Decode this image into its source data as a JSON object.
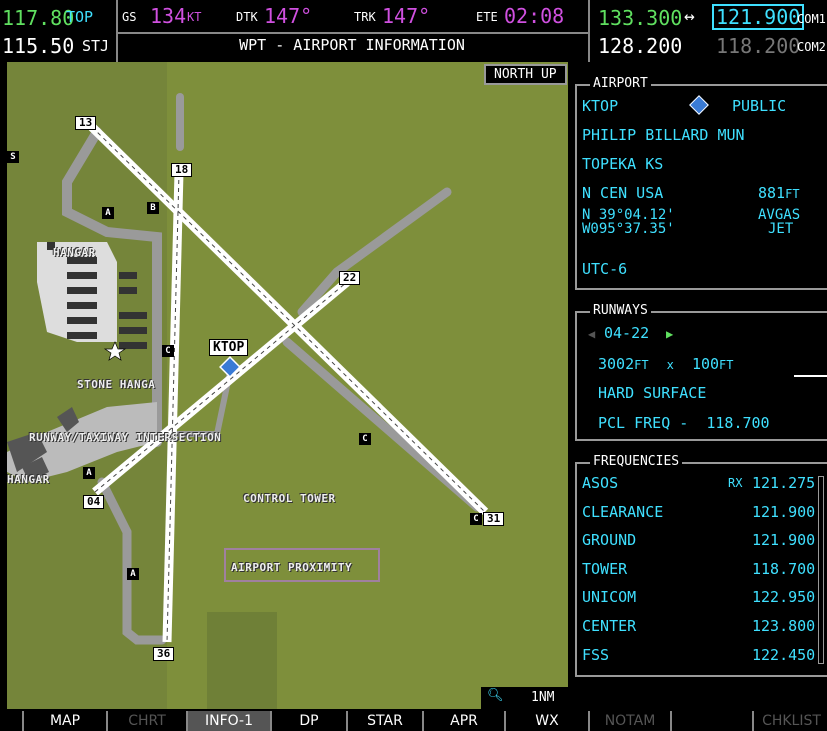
{
  "top": {
    "nav_active": "117.80",
    "nav_standby": "115.50",
    "top_ident": "TOP",
    "stj_ident": "STJ",
    "gs_label": "GS",
    "gs_value": "134",
    "gs_unit": "KT",
    "dtk_label": "DTK",
    "dtk_value": "147°",
    "trk_label": "TRK",
    "trk_value": "147°",
    "ete_label": "ETE",
    "ete_value": "02:08",
    "page_title": "WPT - AIRPORT INFORMATION",
    "com_active": "133.300",
    "com_swap": "↔",
    "com_standby": "121.900",
    "com_label1": "COM1",
    "com2_active": "128.200",
    "com2_standby": "118.200",
    "com_label2": "COM2"
  },
  "map": {
    "orientation": "NORTH UP",
    "range": "1NM",
    "airport_label": "KTOP",
    "runway_labels": [
      "13",
      "18",
      "22",
      "04",
      "31",
      "36"
    ],
    "taxi_labels": [
      "A",
      "B",
      "C",
      "C",
      "A",
      "C",
      "A"
    ],
    "edge_label": "S",
    "text_labels": {
      "hangar1": "HANGAR",
      "stone": "STONE HANGA",
      "rwy_twy": "RUNWAY/TAXIWAY INTERSECTION",
      "hangar2": "HANGAR",
      "tower": "CONTROL TOWER",
      "proximity": "AIRPORT PROXIMITY"
    },
    "colors": {
      "ground": "#7e8f3b",
      "taxiway": "#9a9a9a",
      "runway": "#ffffff"
    }
  },
  "airport": {
    "title": "AIRPORT",
    "ident": "KTOP",
    "use": "PUBLIC",
    "name": "PHILIP BILLARD MUN",
    "city": "TOPEKA KS",
    "region": "N CEN USA",
    "elevation": "881",
    "elevation_unit": "FT",
    "lat": "N 39°04.12'",
    "lon": "W095°37.35'",
    "fuel1": "AVGAS",
    "fuel2": "JET",
    "utc": "UTC-6"
  },
  "runways": {
    "title": "RUNWAYS",
    "designation": "04-22",
    "length": "3002",
    "length_unit": "FT",
    "x": "x",
    "width": "100",
    "width_unit": "FT",
    "surface": "HARD SURFACE",
    "pcl_label": "PCL FREQ -",
    "pcl_freq": "118.700"
  },
  "frequencies": {
    "title": "FREQUENCIES",
    "rx": "RX",
    "items": [
      {
        "name": "ASOS",
        "freq": "121.275"
      },
      {
        "name": "CLEARANCE",
        "freq": "121.900"
      },
      {
        "name": "GROUND",
        "freq": "121.900"
      },
      {
        "name": "TOWER",
        "freq": "118.700"
      },
      {
        "name": "UNICOM",
        "freq": "122.950"
      },
      {
        "name": "CENTER",
        "freq": "123.800"
      },
      {
        "name": "FSS",
        "freq": "122.450"
      }
    ]
  },
  "softkeys": [
    {
      "label": "",
      "state": "dis"
    },
    {
      "label": "MAP",
      "state": "on"
    },
    {
      "label": "CHRT",
      "state": "dis"
    },
    {
      "label": "INFO-1",
      "state": "active"
    },
    {
      "label": "DP",
      "state": "on"
    },
    {
      "label": "STAR",
      "state": "on"
    },
    {
      "label": "APR",
      "state": "on"
    },
    {
      "label": "WX",
      "state": "on"
    },
    {
      "label": "NOTAM",
      "state": "dis"
    },
    {
      "label": "",
      "state": "dis"
    },
    {
      "label": "CHKLIST",
      "state": "dis"
    }
  ]
}
